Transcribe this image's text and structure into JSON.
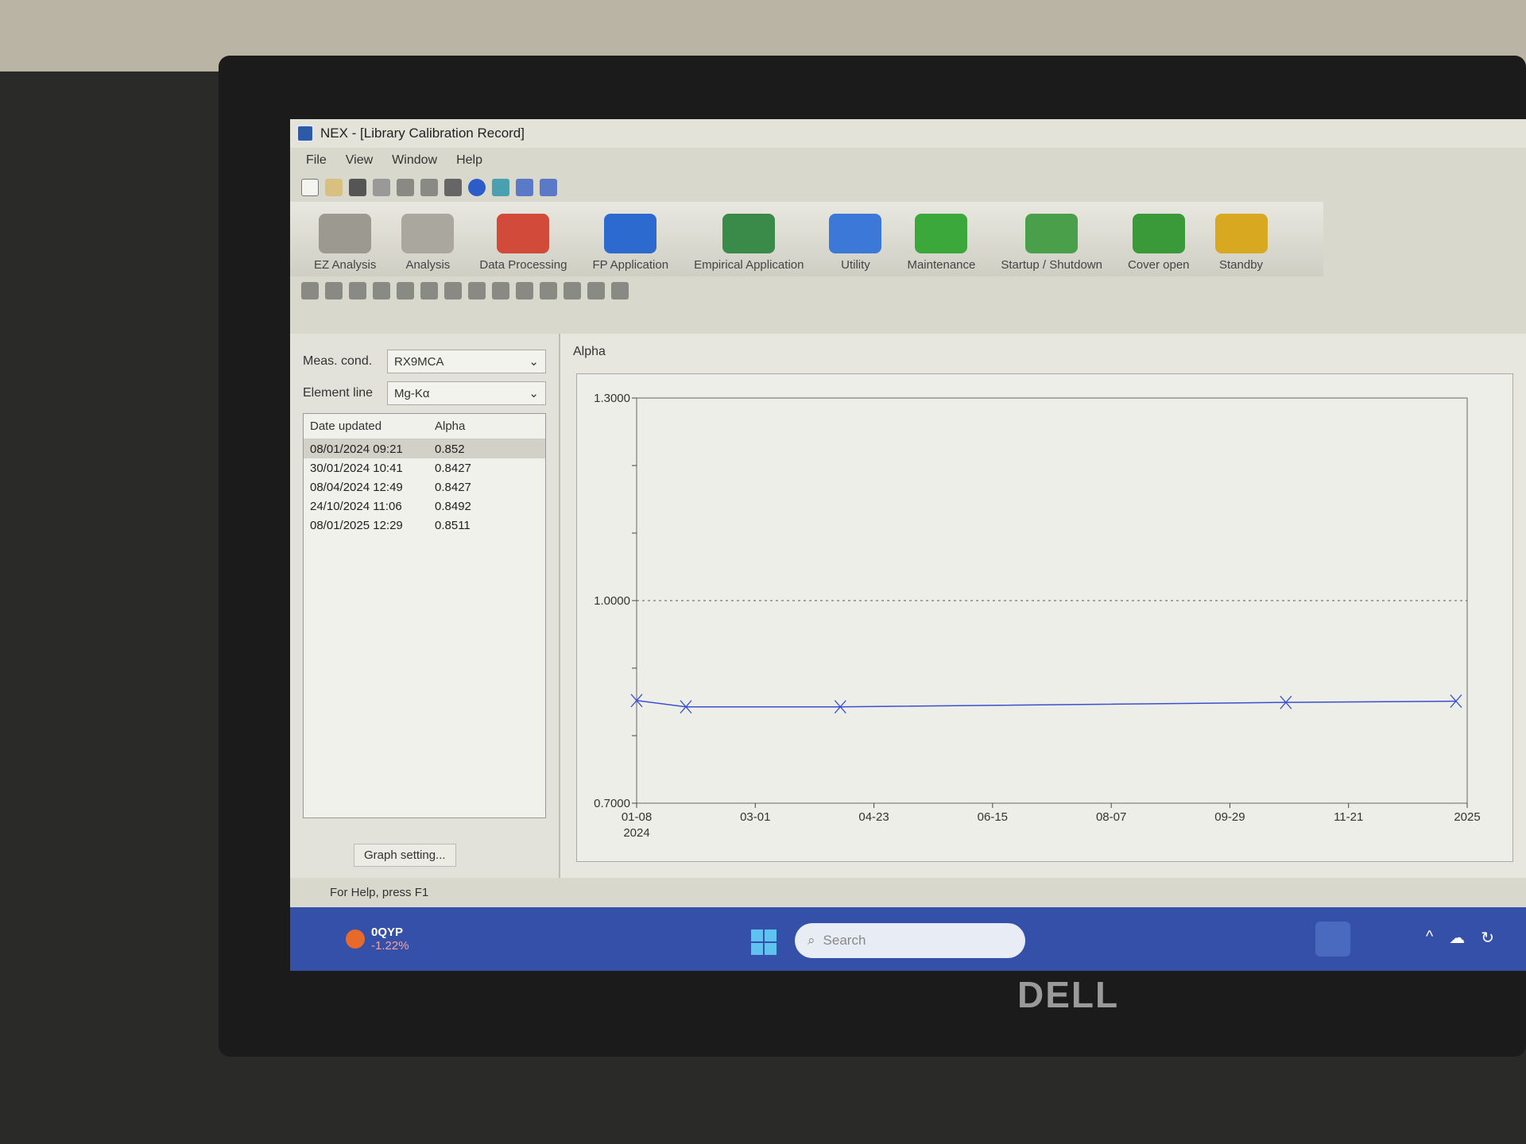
{
  "window": {
    "title": "NEX - [Library Calibration Record]"
  },
  "menu": [
    "File",
    "View",
    "Window",
    "Help"
  ],
  "main_toolbar": [
    {
      "label": "EZ Analysis",
      "color": "#9c9a90"
    },
    {
      "label": "Analysis",
      "color": "#aaa89e"
    },
    {
      "label": "Data Processing",
      "color": "#d24a3a"
    },
    {
      "label": "FP Application",
      "color": "#2d6ad0"
    },
    {
      "label": "Empirical Application",
      "color": "#3a8a4a"
    },
    {
      "label": "Utility",
      "color": "#3b78d8"
    },
    {
      "label": "Maintenance",
      "color": "#3aa83a"
    },
    {
      "label": "Startup / Shutdown",
      "color": "#4aa04a"
    },
    {
      "label": "Cover open",
      "color": "#3a9a3a"
    },
    {
      "label": "Standby",
      "color": "#d8a820"
    }
  ],
  "left_panel": {
    "meas_cond_label": "Meas. cond.",
    "meas_cond_value": "RX9MCA",
    "element_line_label": "Element line",
    "element_line_value": "Mg-Kα",
    "columns": [
      "Date updated",
      "Alpha"
    ],
    "rows": [
      [
        "08/01/2024 09:21",
        "0.852"
      ],
      [
        "30/01/2024 10:41",
        "0.8427"
      ],
      [
        "08/04/2024 12:49",
        "0.8427"
      ],
      [
        "24/10/2024 11:06",
        "0.8492"
      ],
      [
        "08/01/2025 12:29",
        "0.8511"
      ]
    ],
    "graph_setting": "Graph setting..."
  },
  "chart_title": "Alpha",
  "chart_data": {
    "type": "line",
    "title": "Alpha",
    "x": [
      "2024-01-08",
      "2024-01-30",
      "2024-04-08",
      "2024-10-24",
      "2025-01-08"
    ],
    "values": [
      0.852,
      0.8427,
      0.8427,
      0.8492,
      0.8511
    ],
    "ylim": [
      0.7,
      1.3
    ],
    "y_tick_labels": [
      "1.3000",
      "1.0000",
      "0.7000"
    ],
    "x_tick_labels": [
      "01-08\n2024",
      "03-01",
      "04-23",
      "06-15",
      "08-07",
      "09-29",
      "11-21",
      "2025"
    ],
    "reference_line": 1.0,
    "line_color": "#3a4fd0",
    "grid": false
  },
  "status": "For Help, press F1",
  "taskbar": {
    "stock_name": "0QYP",
    "stock_change": "-1.22%",
    "search_placeholder": "Search",
    "accent": "#3550a8"
  }
}
